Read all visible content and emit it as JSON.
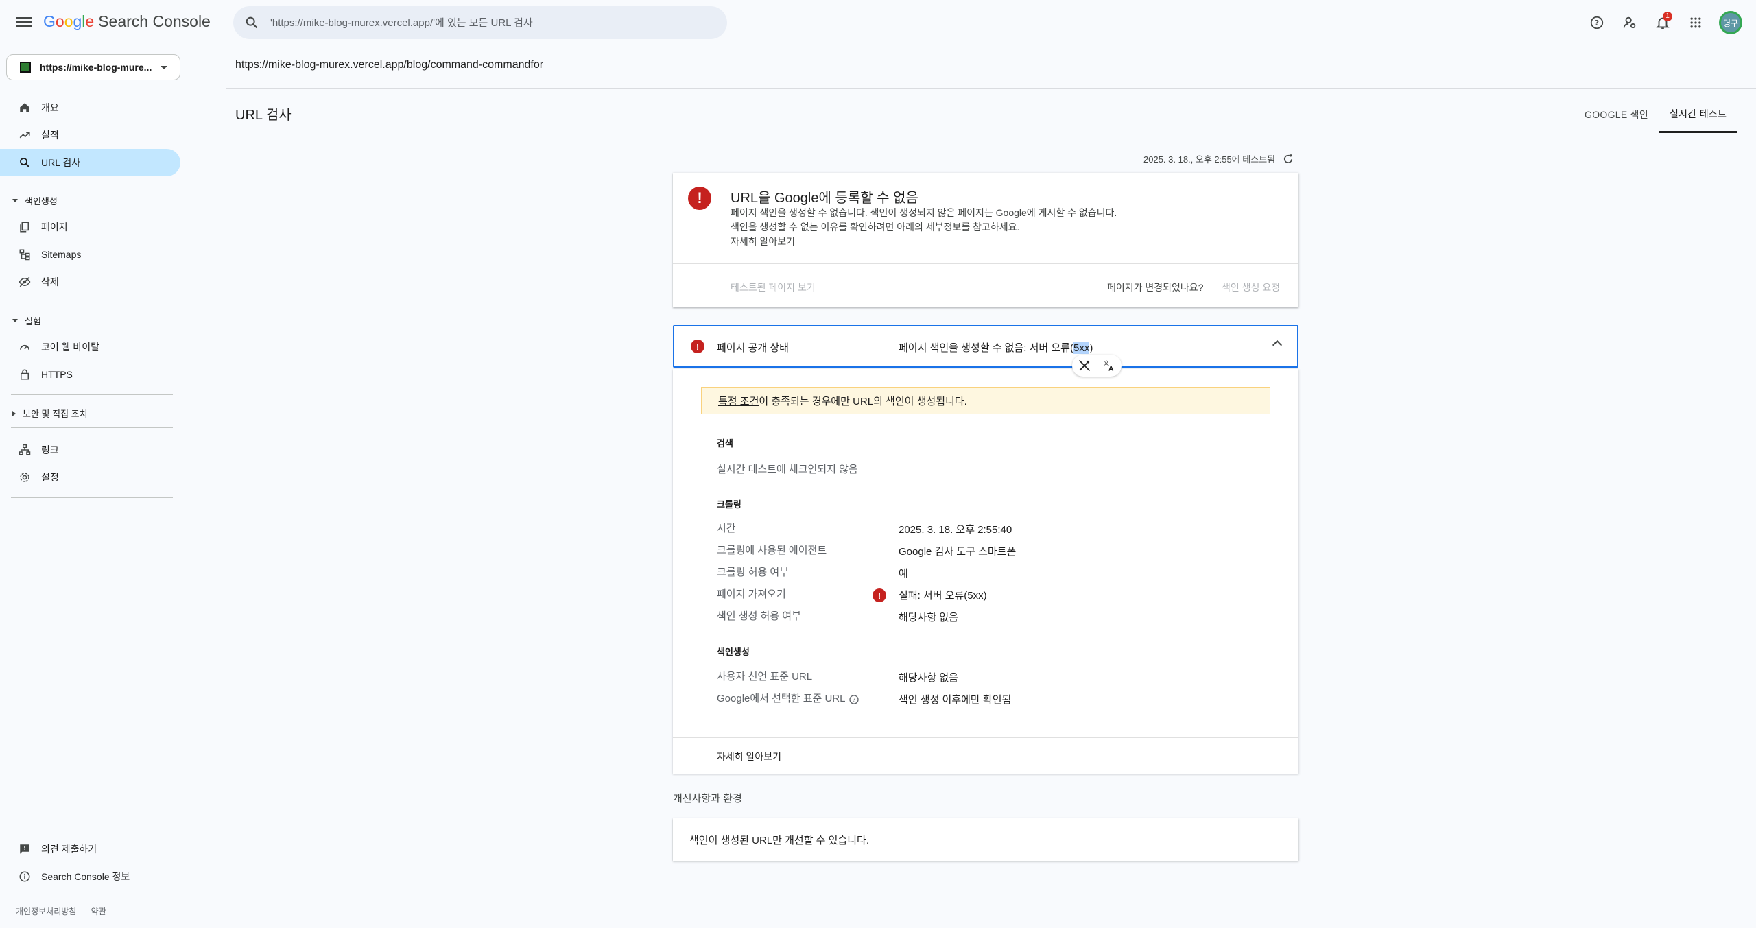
{
  "header": {
    "logo_google": "Google",
    "logo_product": "Search Console",
    "search_placeholder": "'https://mike-blog-murex.vercel.app/'에 있는 모든 URL 검사",
    "notification_count": "1",
    "avatar_text": "명구"
  },
  "sidebar": {
    "property": "https://mike-blog-mure...",
    "items": [
      {
        "label": "개요",
        "icon": "home-icon"
      },
      {
        "label": "실적",
        "icon": "trending-icon"
      },
      {
        "label": "URL 검사",
        "icon": "search-icon"
      },
      {
        "label": "페이지",
        "icon": "pages-icon"
      },
      {
        "label": "Sitemaps",
        "icon": "sitemap-icon"
      },
      {
        "label": "삭제",
        "icon": "eye-off-icon"
      },
      {
        "label": "코어 웹 바이탈",
        "icon": "gauge-icon"
      },
      {
        "label": "HTTPS",
        "icon": "lock-icon"
      },
      {
        "label": "링크",
        "icon": "links-icon"
      },
      {
        "label": "설정",
        "icon": "gear-icon"
      },
      {
        "label": "의견 제출하기",
        "icon": "feedback-icon"
      },
      {
        "label": "Search Console 정보",
        "icon": "info-icon"
      }
    ],
    "sections": {
      "indexing": "색인생성",
      "experience": "실험",
      "security": "보안 및 직접 조치"
    },
    "footer": {
      "privacy": "개인정보처리방침",
      "terms": "약관"
    }
  },
  "main": {
    "inspected_url": "https://mike-blog-murex.vercel.app/blog/command-commandfor",
    "title": "URL 검사",
    "tabs": [
      "GOOGLE 색인",
      "실시간 테스트"
    ],
    "tested_at": "2025. 3. 18., 오후 2:55에 테스트됨",
    "summary": {
      "title": "URL을 Google에 등록할 수 없음",
      "desc": "페이지 색인을 생성할 수 없습니다. 색인이 생성되지 않은 페이지는 Google에 게시할 수 없습니다. 색인을 생성할 수 없는 이유를 확인하려면 아래의 세부정보를 참고하세요.",
      "learn_more": "자세히 알아보기",
      "view_tested": "테스트된 페이지 보기",
      "changed_q": "페이지가 변경되었나요?",
      "request_index": "색인 생성 요청"
    },
    "status": {
      "label": "페이지 공개 상태",
      "value_prefix": "페이지 색인을 생성할 수 없음: 서버 오류(",
      "value_sel": "5xx",
      "value_suffix": ")"
    },
    "detail": {
      "warn_link": "특정 조건",
      "warn_rest": "이 충족되는 경우에만 URL의 색인이 생성됩니다.",
      "search_h": "검색",
      "search_note": "실시간 테스트에 체크인되지 않음",
      "crawl_h": "크롤링",
      "crawl_rows": [
        {
          "label": "시간",
          "value": "2025. 3. 18. 오후 2:55:40"
        },
        {
          "label": "크롤링에 사용된 에이전트",
          "value": "Google 검사 도구 스마트폰"
        },
        {
          "label": "크롤링 허용 여부",
          "value": "예"
        },
        {
          "label": "페이지 가져오기",
          "value": "실패: 서버 오류(5xx)"
        },
        {
          "label": "색인 생성 허용 여부",
          "value": "해당사항 없음"
        }
      ],
      "index_h": "색인생성",
      "index_rows": [
        {
          "label": "사용자 선언 표준 URL",
          "value": "해당사항 없음"
        },
        {
          "label": "Google에서 선택한 표준 URL",
          "value": "색인 생성 이후에만 확인됨"
        }
      ],
      "footer_link": "자세히 알아보기"
    },
    "improvements": {
      "heading": "개선사항과 환경",
      "note": "색인이 생성된 URL만 개선할 수 있습니다."
    }
  },
  "colors": {
    "accent": "#1a73e8",
    "error": "#c5221f",
    "active_nav": "#c2e7ff",
    "warn_bg": "#fef7e0"
  }
}
